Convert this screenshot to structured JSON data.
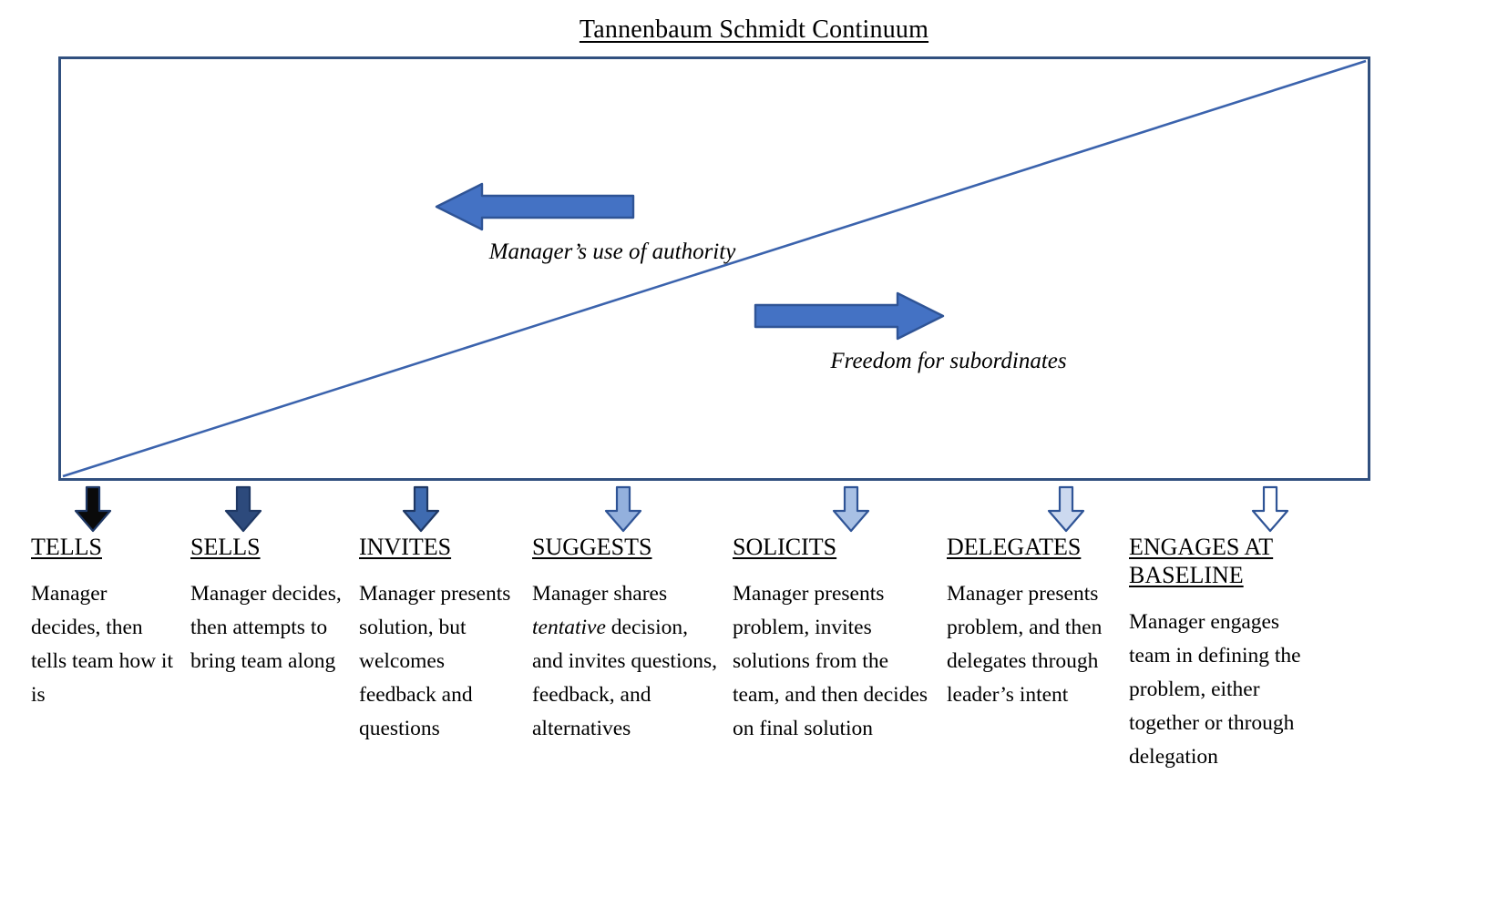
{
  "title": {
    "text": "Tannenbaum Schmidt Continuum"
  },
  "colors": {
    "box_border": "#31507f",
    "diagonal_line": "#3b63ad",
    "arrow_blue_fill": "#4472c4",
    "arrow_blue_border": "#2f5496"
  },
  "continuum": {
    "authority_arrow": {
      "label": "Manager’s use of authority",
      "direction": "left",
      "icon": "left-block-arrow-icon"
    },
    "freedom_arrow": {
      "label": "Freedom for subordinates",
      "direction": "right",
      "icon": "right-block-arrow-icon"
    },
    "diagonal": {
      "description": "diagonal line from bottom-left to top-right"
    }
  },
  "columns": [
    {
      "id": "tells",
      "title": "TELLS",
      "arrow_fill": "#0a0a0a",
      "arrow_stroke": "#1f3864",
      "body_before": "Manager decides, then tells team how it is",
      "body_italic": "",
      "body_after": ""
    },
    {
      "id": "sells",
      "title": "SELLS",
      "arrow_fill": "#2d4a7c",
      "arrow_stroke": "#1f3864",
      "body_before": "Manager decides, then attempts to bring team along",
      "body_italic": "",
      "body_after": ""
    },
    {
      "id": "invites",
      "title": "INVITES",
      "arrow_fill": "#3f6bb0",
      "arrow_stroke": "#1f3864",
      "body_before": "Manager presents solution, but welcomes feedback and questions",
      "body_italic": "",
      "body_after": ""
    },
    {
      "id": "suggests",
      "title": "SUGGESTS",
      "arrow_fill": "#93b0dd",
      "arrow_stroke": "#2f5496",
      "body_before": "Manager shares ",
      "body_italic": "tentative",
      "body_after": " decision, and invites questions, feedback, and alternatives"
    },
    {
      "id": "solicits",
      "title": "SOLICITS",
      "arrow_fill": "#a8c0e4",
      "arrow_stroke": "#2f5496",
      "body_before": "Manager presents problem, invites solutions from the team, and then decides on final solution",
      "body_italic": "",
      "body_after": ""
    },
    {
      "id": "delegates",
      "title": "DELEGATES",
      "arrow_fill": "#ccd9ef",
      "arrow_stroke": "#2f5496",
      "body_before": "Manager presents problem, and then delegates through leader’s intent",
      "body_italic": "",
      "body_after": ""
    },
    {
      "id": "engages-at-baseline",
      "title": "ENGAGES AT BASELINE",
      "arrow_fill": "#ffffff",
      "arrow_stroke": "#2f5496",
      "body_before": "Manager engages team in defining the problem, either together or through delegation",
      "body_italic": "",
      "body_after": ""
    }
  ]
}
